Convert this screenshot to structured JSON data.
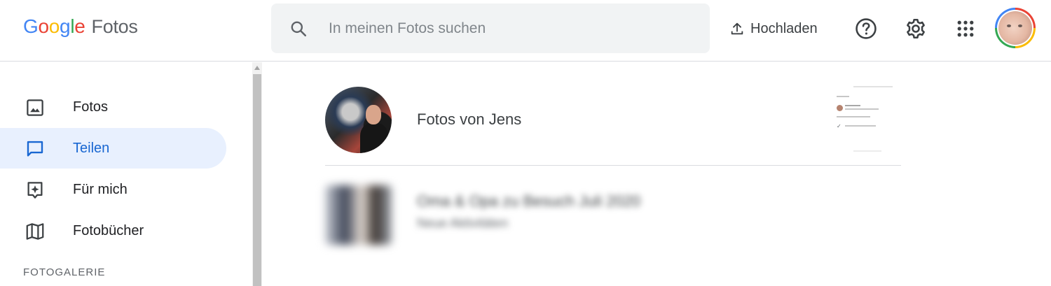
{
  "header": {
    "logo": {
      "g1": "G",
      "o1": "o",
      "o2": "o",
      "g2": "g",
      "l": "l",
      "e": "e",
      "product": "Fotos"
    },
    "search": {
      "placeholder": "In meinen Fotos suchen",
      "value": ""
    },
    "upload_label": "Hochladen",
    "icons": [
      "search-icon",
      "upload-icon",
      "help-icon",
      "settings-icon",
      "apps-icon",
      "account-avatar"
    ]
  },
  "sidebar": {
    "items": [
      {
        "label": "Fotos",
        "icon": "photo-icon",
        "active": false
      },
      {
        "label": "Teilen",
        "icon": "chat-icon",
        "active": true
      },
      {
        "label": "Für mich",
        "icon": "sparkle-icon",
        "active": false
      },
      {
        "label": "Fotobücher",
        "icon": "book-icon",
        "active": false
      }
    ],
    "section_label": "FOTOGALERIE"
  },
  "main": {
    "shares": [
      {
        "title": "Fotos von Jens"
      },
      {
        "title": "Oma & Opa zu Besuch Juli 2020",
        "subtitle": "Neue Aktivitäten",
        "blurred": true
      }
    ]
  },
  "colors": {
    "accent": "#1967d2",
    "active_bg": "#e8f0fe",
    "search_bg": "#f1f3f4",
    "divider": "#dadce0"
  }
}
